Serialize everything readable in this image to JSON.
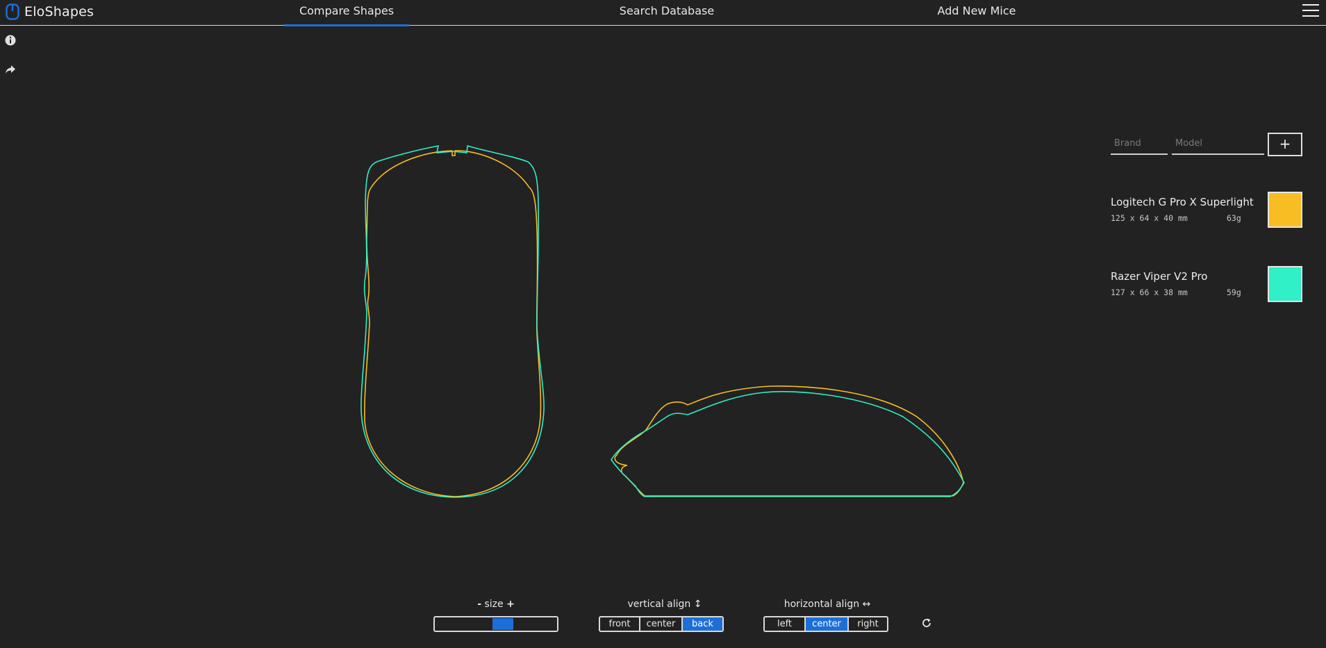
{
  "app": {
    "name": "EloShapes"
  },
  "nav": {
    "tabs": [
      {
        "label": "Compare Shapes",
        "active": true
      },
      {
        "label": "Search Database",
        "active": false
      },
      {
        "label": "Add New Mice",
        "active": false
      }
    ]
  },
  "sidebar": {
    "icons": [
      "info-icon",
      "share-icon",
      "menu-icon"
    ]
  },
  "search": {
    "brand_placeholder": "Brand",
    "model_placeholder": "Model",
    "add_label": "+"
  },
  "mice": [
    {
      "name": "Logitech G Pro X Superlight",
      "dims": "125 x 64 x 40 mm",
      "weight": "63g",
      "color": "#f9bd24"
    },
    {
      "name": "Razer Viper V2 Pro",
      "dims": "127 x 66 x 38 mm",
      "weight": "59g",
      "color": "#2ff0c6"
    }
  ],
  "controls": {
    "size": {
      "minus": "-",
      "label": "size",
      "plus": "+",
      "value_fraction": 0.57
    },
    "vertical_align": {
      "label": "vertical align ↕",
      "options": [
        "front",
        "center",
        "back"
      ],
      "selected": "back"
    },
    "horizontal_align": {
      "label": "horizontal align ↔",
      "options": [
        "left",
        "center",
        "right"
      ],
      "selected": "center"
    }
  },
  "colors": {
    "accent": "#1c6fd9",
    "background": "#222222"
  }
}
